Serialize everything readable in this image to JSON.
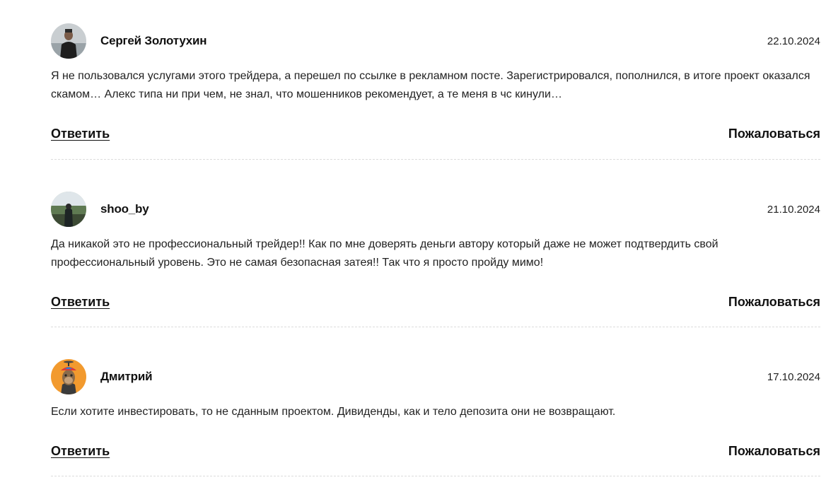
{
  "comments": [
    {
      "author": "Сергей Золотухин",
      "date": "22.10.2024",
      "text": "Я не пользовался услугами этого трейдера, а перешел по ссылке в рекламном посте. Зарегистрировался, пополнился, в итоге проект оказался скамом… Алекс типа ни при чем, не знал, что мошенников рекомендует, а те меня в чс кинули…",
      "reply_label": "Ответить",
      "report_label": "Пожаловаться",
      "avatar_icon": "user-photo-man-icon"
    },
    {
      "author": "shoo_by",
      "date": "21.10.2024",
      "text": "Да никакой это не профессиональный трейдер!! Как по мне доверять деньги автору который даже не может подтвердить свой профессиональный уровень. Это не самая безопасная затея!! Так что я просто пройду мимо!",
      "reply_label": "Ответить",
      "report_label": "Пожаловаться",
      "avatar_icon": "user-photo-landscape-icon"
    },
    {
      "author": "Дмитрий",
      "date": "17.10.2024",
      "text": "Если хотите инвестировать, то не сданным проектом. Дивиденды, как и тело депозита они не возвращают.",
      "reply_label": "Ответить",
      "report_label": "Пожаловаться",
      "avatar_icon": "ape-cartoon-avatar-icon"
    }
  ],
  "colors": {
    "text": "#222222",
    "divider": "#dcdcdc",
    "avatar3_bg": "#f29a2e"
  }
}
